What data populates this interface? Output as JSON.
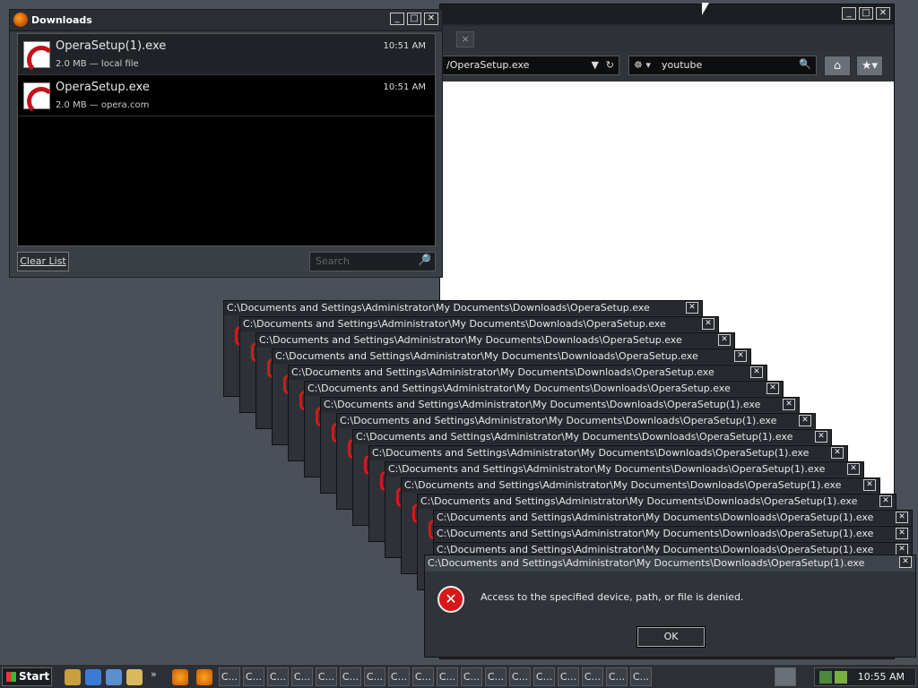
{
  "browser": {
    "url_value": "/OperaSetup.exe",
    "search_value": "youtube",
    "tab_close_label": "×",
    "new_tab_label": "+",
    "home_icon": "home-icon",
    "bookmarks_icon": "bookmarks-icon"
  },
  "downloads": {
    "title": "Downloads",
    "items": [
      {
        "name": "OperaSetup(1).exe",
        "meta": "2.0 MB — local file",
        "time": "10:51 AM"
      },
      {
        "name": "OperaSetup.exe",
        "meta": "2.0 MB — opera.com",
        "time": "10:51 AM"
      }
    ],
    "clear_label": "Clear List",
    "search_placeholder": "Search"
  },
  "error_dialogs": {
    "titles": [
      "C:\\Documents and Settings\\Administrator\\My Documents\\Downloads\\OperaSetup.exe",
      "C:\\Documents and Settings\\Administrator\\My Documents\\Downloads\\OperaSetup.exe",
      "C:\\Documents and Settings\\Administrator\\My Documents\\Downloads\\OperaSetup.exe",
      "C:\\Documents and Settings\\Administrator\\My Documents\\Downloads\\OperaSetup.exe",
      "C:\\Documents and Settings\\Administrator\\My Documents\\Downloads\\OperaSetup.exe",
      "C:\\Documents and Settings\\Administrator\\My Documents\\Downloads\\OperaSetup.exe",
      "C:\\Documents and Settings\\Administrator\\My Documents\\Downloads\\OperaSetup(1).exe",
      "C:\\Documents and Settings\\Administrator\\My Documents\\Downloads\\OperaSetup(1).exe",
      "C:\\Documents and Settings\\Administrator\\My Documents\\Downloads\\OperaSetup(1).exe",
      "C:\\Documents and Settings\\Administrator\\My Documents\\Downloads\\OperaSetup(1).exe",
      "C:\\Documents and Settings\\Administrator\\My Documents\\Downloads\\OperaSetup(1).exe",
      "C:\\Documents and Settings\\Administrator\\My Documents\\Downloads\\OperaSetup(1).exe",
      "C:\\Documents and Settings\\Administrator\\My Documents\\Downloads\\OperaSetup(1).exe",
      "C:\\Documents and Settings\\Administrator\\My Documents\\Downloads\\OperaSetup(1).exe",
      "C:\\Documents and Settings\\Administrator\\My Documents\\Downloads\\OperaSetup(1).exe",
      "C:\\Documents and Settings\\Administrator\\My Documents\\Downloads\\OperaSetup(1).exe"
    ],
    "active_title": "C:\\Documents and Settings\\Administrator\\My Documents\\Downloads\\OperaSetup(1).exe",
    "message": "Access to the specified device, path, or file is denied.",
    "ok_label": "OK",
    "close_label": "✕"
  },
  "window_controls": {
    "minimize": "_",
    "maximize": "□",
    "close": "✕"
  },
  "taskbar": {
    "start_label": "Start",
    "overflow_label": "»",
    "task_label": "C...",
    "task_count": 18,
    "clock": "10:55 AM"
  }
}
